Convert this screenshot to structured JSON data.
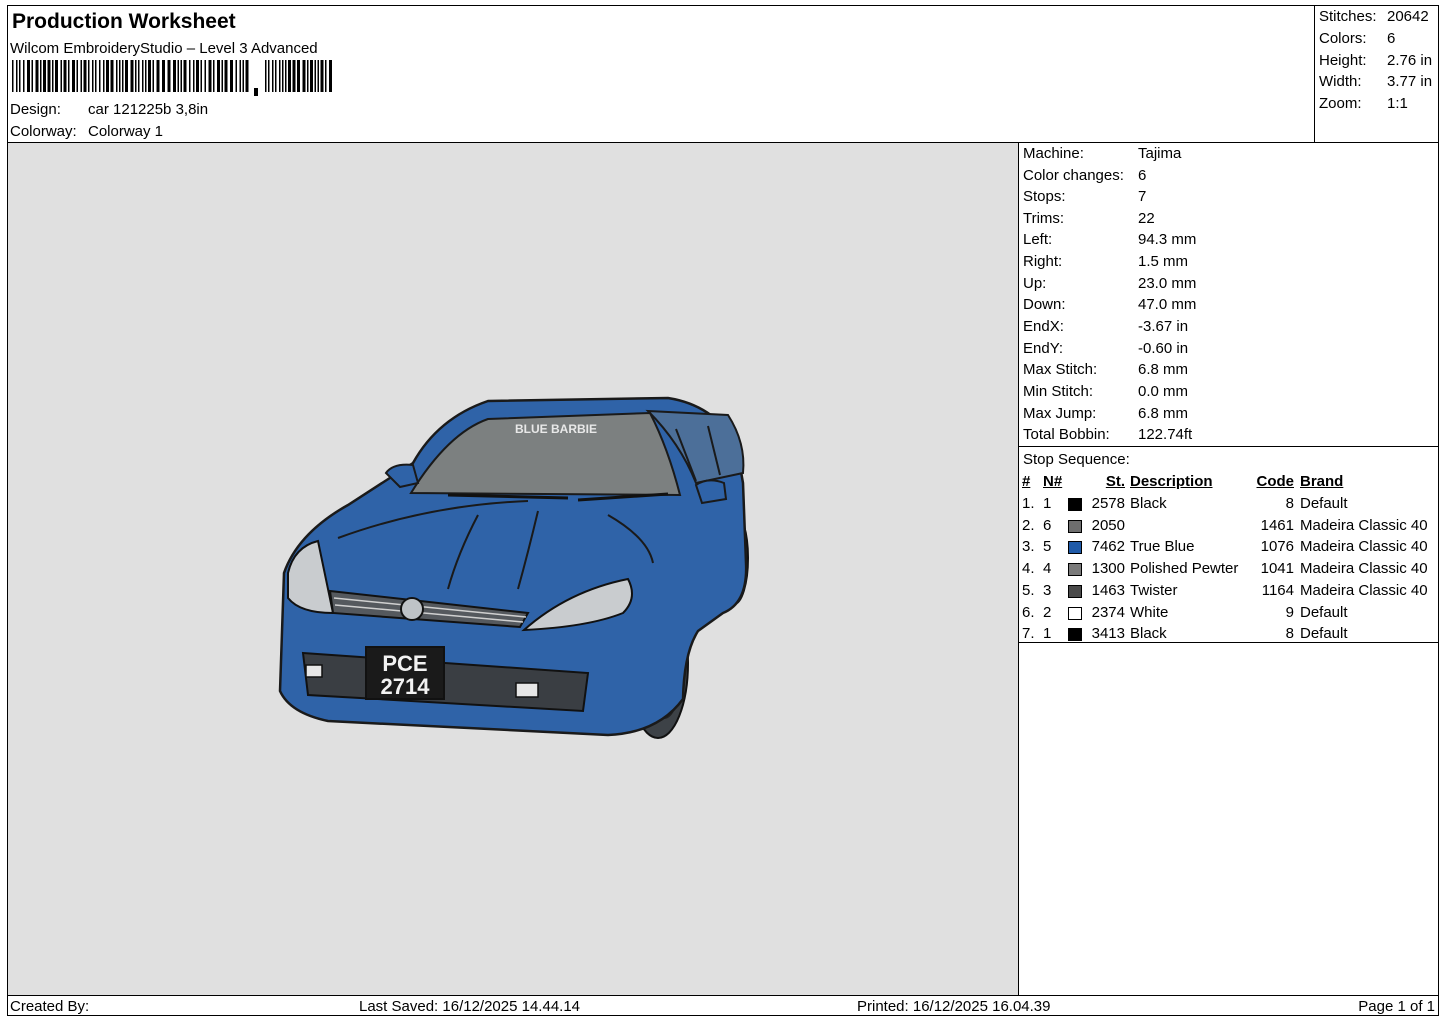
{
  "header": {
    "title": "Production Worksheet",
    "software": "Wilcom EmbroideryStudio – Level 3 Advanced",
    "design_label": "Design:",
    "design_value": "car 121225b 3,8in",
    "colorway_label": "Colorway:",
    "colorway_value": "Colorway 1"
  },
  "stats": [
    {
      "label": "Stitches:",
      "value": "20642"
    },
    {
      "label": "Colors:",
      "value": "6"
    },
    {
      "label": "Height:",
      "value": "2.76 in"
    },
    {
      "label": "Width:",
      "value": "3.77 in"
    },
    {
      "label": "Zoom:",
      "value": "1:1"
    }
  ],
  "machine_info": [
    {
      "label": "Machine:",
      "value": "Tajima"
    },
    {
      "label": "Color changes:",
      "value": "6"
    },
    {
      "label": "Stops:",
      "value": "7"
    },
    {
      "label": "Trims:",
      "value": "22"
    },
    {
      "label": "Left:",
      "value": "94.3 mm"
    },
    {
      "label": "Right:",
      "value": "1.5 mm"
    },
    {
      "label": "Up:",
      "value": "23.0 mm"
    },
    {
      "label": "Down:",
      "value": "47.0 mm"
    },
    {
      "label": "EndX:",
      "value": "-3.67 in"
    },
    {
      "label": "EndY:",
      "value": "-0.60 in"
    },
    {
      "label": "Max Stitch:",
      "value": "6.8 mm"
    },
    {
      "label": "Min Stitch:",
      "value": "0.0 mm"
    },
    {
      "label": "Max Jump:",
      "value": "6.8 mm"
    },
    {
      "label": "Total Bobbin:",
      "value": "122.74ft"
    }
  ],
  "stop_sequence": {
    "title": "Stop Sequence:",
    "headers": {
      "num": "#",
      "n": "N#",
      "st": "St.",
      "desc": "Description",
      "code": "Code",
      "brand": "Brand"
    },
    "rows": [
      {
        "num": "1.",
        "n": "1",
        "color": "#000000",
        "st": "2578",
        "desc": "Black",
        "code": "8",
        "brand": "Default"
      },
      {
        "num": "2.",
        "n": "6",
        "color": "#6e6e6e",
        "st": "2050",
        "desc": "",
        "code": "1461",
        "brand": "Madeira Classic 40"
      },
      {
        "num": "3.",
        "n": "5",
        "color": "#1f5aa8",
        "st": "7462",
        "desc": "True Blue",
        "code": "1076",
        "brand": "Madeira Classic 40"
      },
      {
        "num": "4.",
        "n": "4",
        "color": "#7a7a7a",
        "st": "1300",
        "desc": "Polished Pewter",
        "code": "1041",
        "brand": "Madeira Classic 40"
      },
      {
        "num": "5.",
        "n": "3",
        "color": "#4a4a4a",
        "st": "1463",
        "desc": "Twister",
        "code": "1164",
        "brand": "Madeira Classic 40"
      },
      {
        "num": "6.",
        "n": "2",
        "color": "#ffffff",
        "st": "2374",
        "desc": "White",
        "code": "9",
        "brand": "Default"
      },
      {
        "num": "7.",
        "n": "1",
        "color": "#000000",
        "st": "3413",
        "desc": "Black",
        "code": "8",
        "brand": "Default"
      }
    ]
  },
  "design_preview": {
    "windshield_text": "BLUE BARBIE",
    "plate_line1": "PCE",
    "plate_line2": "2714"
  },
  "footer": {
    "created_by": "Created By:",
    "last_saved": "Last Saved: 16/12/2025 14.44.14",
    "printed": "Printed: 16/12/2025 16.04.39",
    "page": "Page 1 of 1"
  }
}
